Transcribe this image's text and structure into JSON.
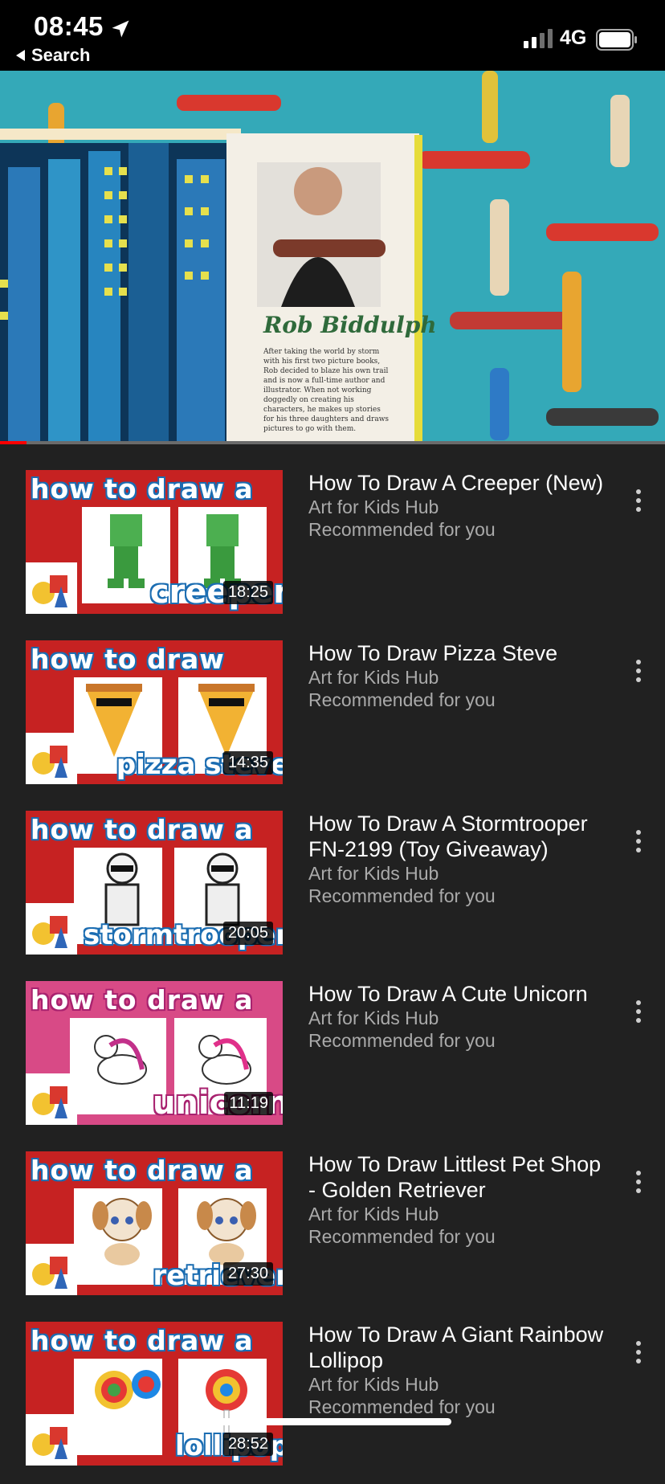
{
  "status_bar": {
    "time": "08:45",
    "back_label": "Search",
    "network": "4G",
    "icons": [
      "location-arrow-icon",
      "signal-icon",
      "battery-icon"
    ]
  },
  "player": {
    "page_title": "Rob Biddulph",
    "page_text": "After taking the world by storm with his first two picture books, Rob decided to blaze his own trail and is now a full-time author and illustrator. When not working doggedly on creating his characters, he makes up stories for his three daughters and draws pictures to go with them.",
    "progress": 0.04
  },
  "colors": {
    "accent": "#ff0000",
    "background": "#212121",
    "secondary_text": "#aaaaaa"
  },
  "videos": [
    {
      "title": "How To Draw A Creeper (New)",
      "channel": "Art for Kids Hub",
      "reason": "Recommended for you",
      "duration": "18:25",
      "thumb_heading": "how to draw a",
      "thumb_subject": "creeper"
    },
    {
      "title": "How To Draw Pizza Steve",
      "channel": "Art for Kids Hub",
      "reason": "Recommended for you",
      "duration": "14:35",
      "thumb_heading": "how to draw",
      "thumb_subject": "pizza steve"
    },
    {
      "title": "How To Draw A Stormtrooper FN-2199 (Toy Giveaway)",
      "channel": "Art for Kids Hub",
      "reason": "Recommended for you",
      "duration": "20:05",
      "thumb_heading": "how to draw a",
      "thumb_subject": "stormtrooper"
    },
    {
      "title": "How To Draw A Cute Unicorn",
      "channel": "Art for Kids Hub",
      "reason": "Recommended for you",
      "duration": "11:19",
      "thumb_heading": "how to draw a",
      "thumb_subject": "unicorn"
    },
    {
      "title": "How To Draw Littlest Pet Shop - Golden Retriever",
      "channel": "Art for Kids Hub",
      "reason": "Recommended for you",
      "duration": "27:30",
      "thumb_heading": "how to draw a",
      "thumb_subject": "retriever"
    },
    {
      "title": "How To Draw A Giant Rainbow Lollipop",
      "channel": "Art for Kids Hub",
      "reason": "Recommended for you",
      "duration": "28:52",
      "thumb_heading": "how to draw a",
      "thumb_subject": "lollipop"
    }
  ]
}
